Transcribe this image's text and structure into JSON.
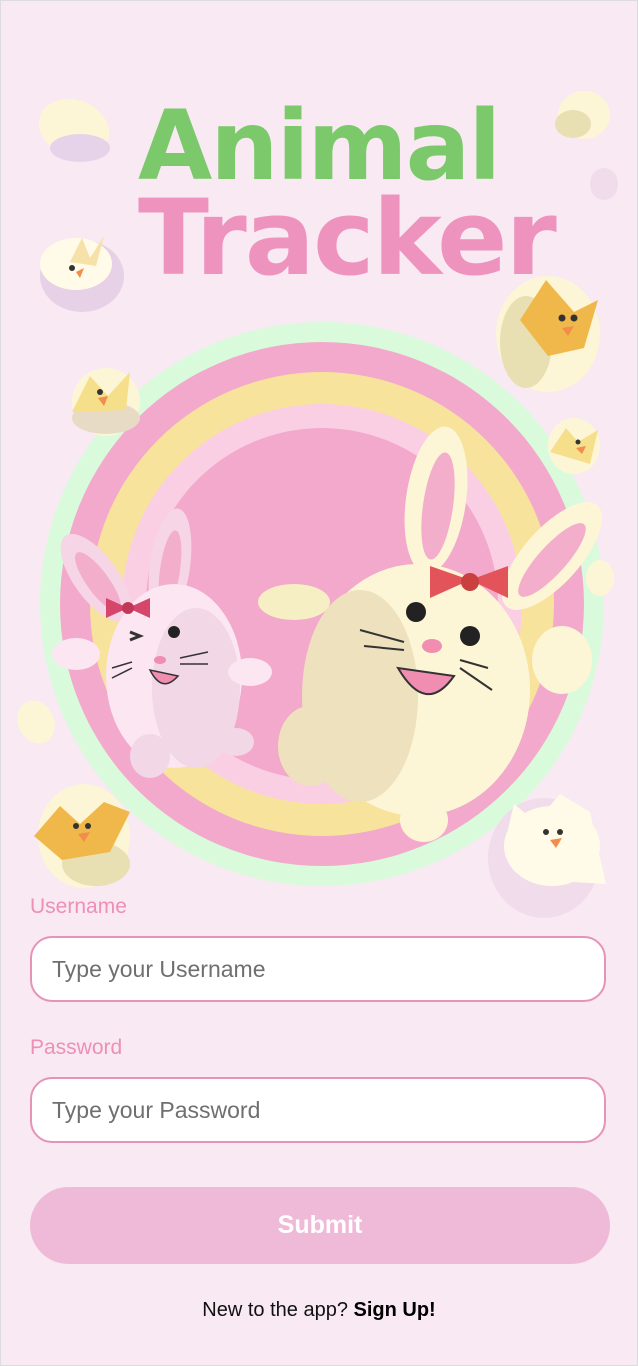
{
  "header": {
    "title_line1": "Animal",
    "title_line2": "Tracker"
  },
  "form": {
    "username_label": "Username",
    "username_placeholder": "Type your Username",
    "password_label": "Password",
    "password_placeholder": "Type your Password",
    "submit_label": "Submit"
  },
  "footer": {
    "prompt": "New to the app?",
    "signup_label": "Sign Up!"
  },
  "colors": {
    "background": "#f8e9f3",
    "title_green": "#7bc96b",
    "title_pink": "#ee93bd",
    "accent": "#e693b8",
    "button": "#efbad8"
  },
  "illustration": {
    "subject": "two easter bunnies with eggs and chicks in rainbow",
    "icons": [
      "bunny-icon",
      "egg-icon",
      "chick-icon"
    ]
  }
}
